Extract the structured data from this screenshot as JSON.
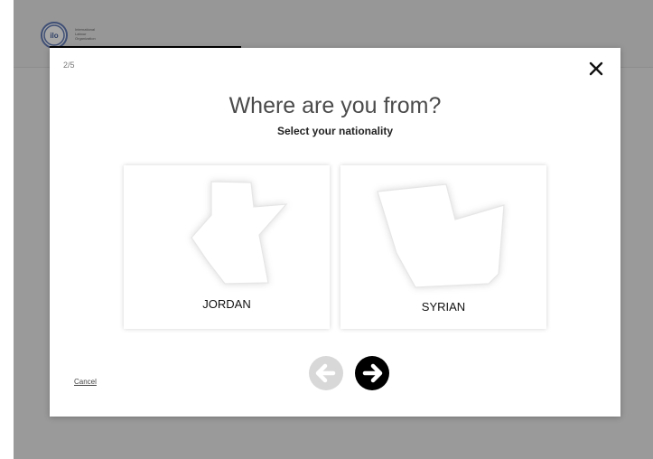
{
  "header": {
    "logo_lines": [
      "International",
      "Labour",
      "Organization"
    ],
    "progress_fraction": 0.4
  },
  "modal": {
    "step": "2/5",
    "title": "Where are you from?",
    "subtitle": "Select your nationality",
    "close_icon": "close-icon",
    "options": [
      {
        "label": "JORDAN",
        "icon": "jordan-map-icon"
      },
      {
        "label": "SYRIAN",
        "icon": "syria-map-icon"
      }
    ],
    "prev_icon": "arrow-left-icon",
    "next_icon": "arrow-right-icon",
    "cancel": "Cancel"
  },
  "colors": {
    "overlay": "#9a9a9a",
    "accent": "#000000",
    "disabled": "#d8d8d8"
  }
}
